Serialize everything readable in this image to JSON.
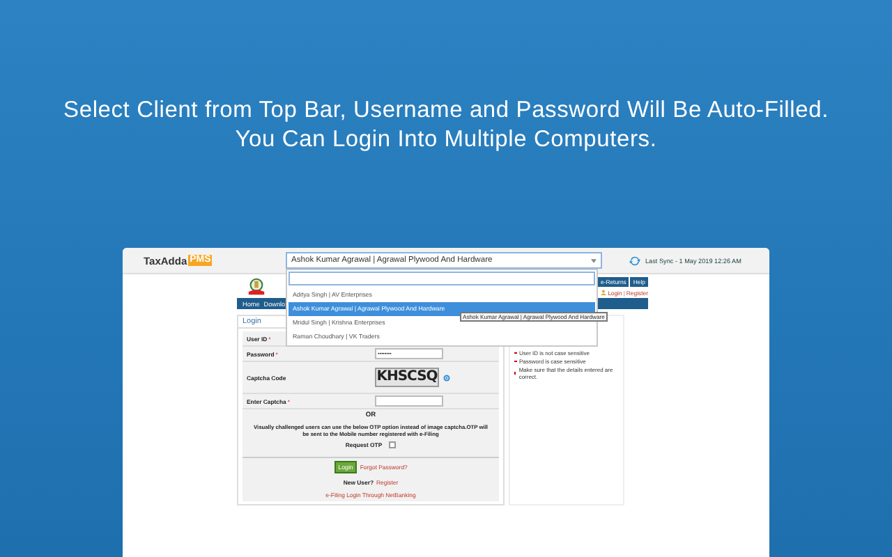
{
  "headline": [
    "Select Client from Top Bar, Username and Password Will Be Auto-Filled.",
    "You Can Login Into Multiple Computers."
  ],
  "topbar": {
    "logo": "TaxAdda",
    "logo_badge": "PMS",
    "client_select": {
      "value": "Ashok Kumar Agrawal | Agrawal Plywood And Hardware",
      "expanded": true
    },
    "last_sync": "Last Sync - 1 May 2019 12:26 AM"
  },
  "dropdown": {
    "options": [
      {
        "label": "Aditya Singh | AV Enterprises",
        "selected": false
      },
      {
        "label": "Ashok Kumar Agrawal | Agrawal Plywood And Hardware",
        "selected": true
      },
      {
        "label": "Mridul Singh | Krishna Enterprises",
        "selected": false
      },
      {
        "label": "Raman Choudhary | VK Traders",
        "selected": false
      }
    ],
    "tooltip": "Ashok Kumar Agrawal | Agrawal Plywood And Hardware"
  },
  "site": {
    "header_buttons": [
      "e-Returns",
      "Help"
    ],
    "login_link": "Login",
    "link_separator": "|",
    "register_link": "Register",
    "menu": [
      "Home",
      "Downlo"
    ]
  },
  "login": {
    "title": "Login",
    "required_mark": "*",
    "fields": [
      {
        "label": "User ID",
        "required": true,
        "kind": "label"
      },
      {
        "label": "Password",
        "required": true,
        "kind": "text",
        "value": "••••••••"
      },
      {
        "label": "Captcha Code",
        "required": false,
        "kind": "captcha",
        "captcha": "KHSCSQ"
      },
      {
        "label": "Enter Captcha",
        "required": true,
        "kind": "text"
      }
    ],
    "or_text": "OR",
    "otp_note": "Visually challenged users can use the below OTP option instead of image captcha.OTP will be sent to the Mobile number registered with e-Filing",
    "request_otp": {
      "label": "Request OTP",
      "checked": false
    },
    "login_button": "Login",
    "forgot_link": "Forgot Password?",
    "new_user": "New User?",
    "register_link": "Register",
    "netbanking_link": "e-Filing Login Through NetBanking"
  },
  "tips": [
    "User ID is not case sensitive",
    "Password is case sensitive",
    "Make sure that the details entered are correct."
  ]
}
